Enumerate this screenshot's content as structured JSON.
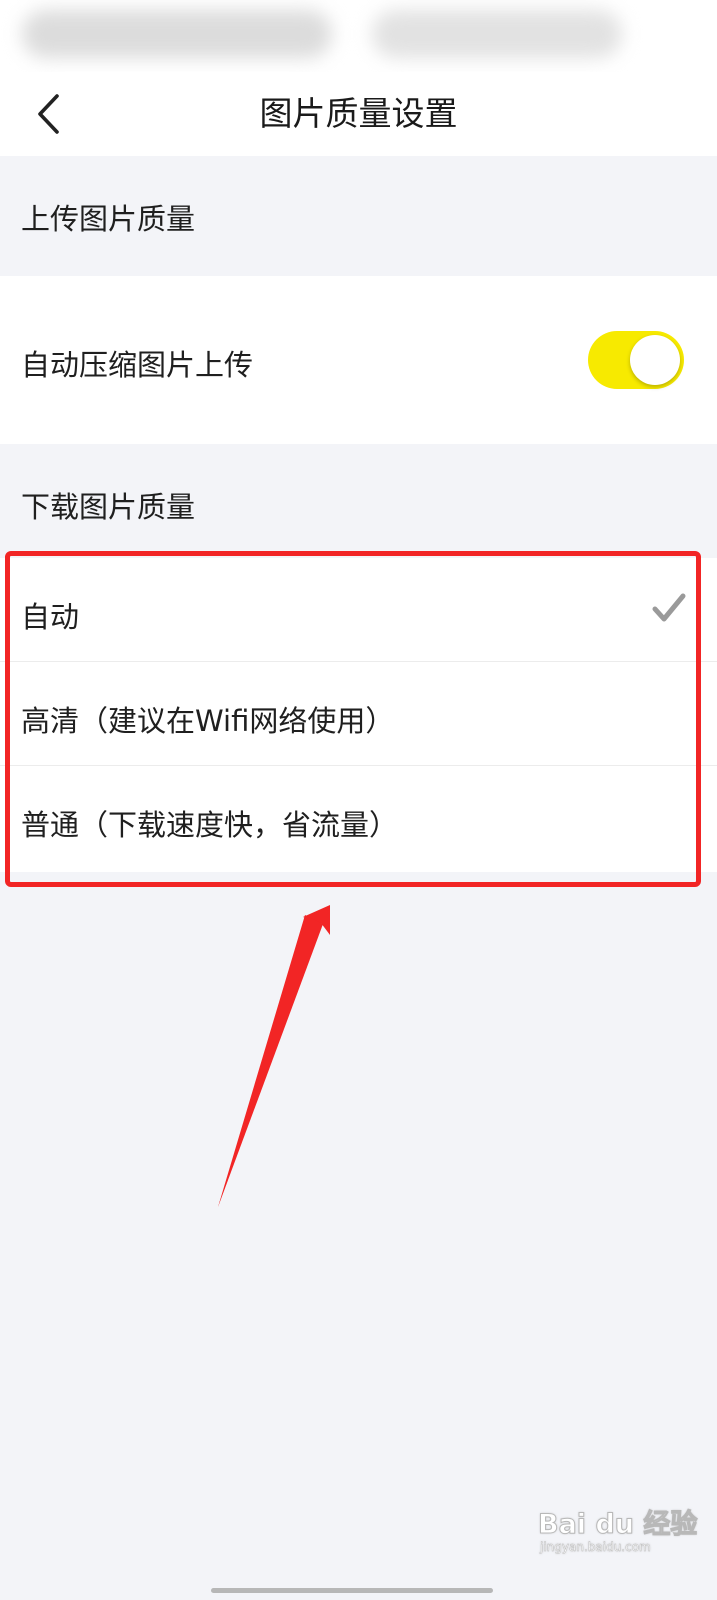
{
  "nav": {
    "title": "图片质量设置"
  },
  "upload_section": {
    "header": "上传图片质量",
    "auto_compress_label": "自动压缩图片上传",
    "auto_compress_enabled": true
  },
  "download_section": {
    "header": "下载图片质量",
    "options": [
      {
        "label": "自动",
        "selected": true
      },
      {
        "label": "高清（建议在Wifi网络使用）",
        "selected": false
      },
      {
        "label": "普通（下载速度快，省流量）",
        "selected": false
      }
    ]
  },
  "watermark": {
    "brand": "Bai du 经验",
    "url": "jingyan.baidu.com"
  },
  "colors": {
    "toggle_on": "#f7ea00",
    "annotation_red": "#f22525",
    "check_gray": "#9a9a9a",
    "background": "#f3f4f8"
  },
  "icons": {
    "back": "chevron-left-icon",
    "selected": "checkmark-icon"
  }
}
